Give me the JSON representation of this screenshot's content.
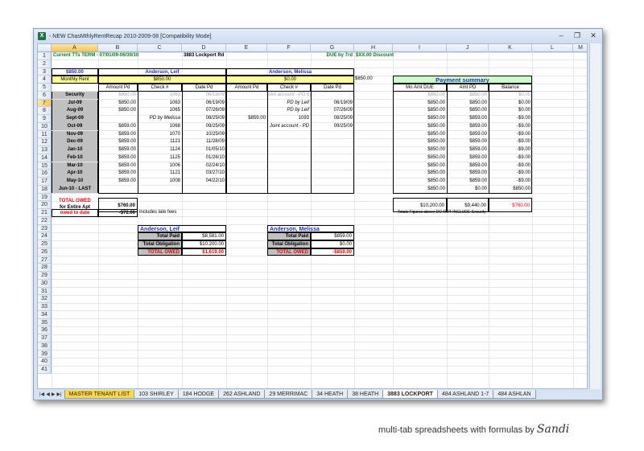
{
  "window": {
    "title": "- NEW ChasMthlyRentRecap 2010-2009-08  [Compatibility Mode]",
    "app_icon": "excel-icon"
  },
  "columns": [
    "A",
    "B",
    "C",
    "D",
    "E",
    "F",
    "G",
    "H",
    "I",
    "J",
    "K",
    "L",
    "M"
  ],
  "rows": [
    "1",
    "2",
    "3",
    "4",
    "5",
    "6",
    "7",
    "8",
    "9",
    "10",
    "11",
    "12",
    "13",
    "14",
    "15",
    "16",
    "17",
    "18",
    "19",
    "20",
    "21",
    "22",
    "23",
    "24",
    "25",
    "26",
    "27",
    "28",
    "29",
    "30",
    "31",
    "32",
    "33",
    "34",
    "35",
    "36",
    "37",
    "38",
    "39",
    "40",
    "41"
  ],
  "header": {
    "term": "Current TTs TERM -  07/01/09-06/30/10",
    "address": "3883 Lockport Rd",
    "due": "DUE by 7rd",
    "discount": "$XX.00 Discount"
  },
  "rent": {
    "amount": "$850.00",
    "label": "Monthly Rent",
    "h4": "$850.00"
  },
  "tenant1": {
    "name": "Anderson, Leif",
    "rent": "$850.00",
    "col_amt": "Amount Pd",
    "col_check": "Check #",
    "col_date": "Date Pd"
  },
  "tenant2": {
    "name": "Anderson, Melissa",
    "rent": "$0.00",
    "col_amt": "Amount Pd",
    "col_check": "Check #",
    "col_date": "Date Pd"
  },
  "summary": {
    "title": "Payment summary",
    "col_due": "Mo Amt DUE",
    "col_pd": "Amt PD",
    "col_bal": "Balance"
  },
  "ledger": [
    {
      "month": "Security",
      "a1": "$850.00",
      "c1": "1063",
      "d1": "06/19/09",
      "a2": "",
      "c2": "joint account - PD by Leif",
      "d2": "",
      "due": "$850.00",
      "pd": "$850.00",
      "bal": "$0.00"
    },
    {
      "month": "Jul-09",
      "a1": "$850.00",
      "c1": "1063",
      "d1": "06/19/09",
      "a2": "",
      "c2": "PD by Leif",
      "d2": "06/19/09",
      "due": "$850.00",
      "pd": "$850.00",
      "bal": "$0.00"
    },
    {
      "month": "Aug-09",
      "a1": "$850.00",
      "c1": "1065",
      "d1": "07/26/09",
      "a2": "",
      "c2": "PD by Leif",
      "d2": "07/26/09",
      "due": "$850.00",
      "pd": "$850.00",
      "bal": "$0.00"
    },
    {
      "month": "Sept-09",
      "a1": "",
      "c1": "PD by Melissa",
      "d1": "08/25/09",
      "a2": "$859.00",
      "c2": "1093",
      "d2": "08/25/09",
      "due": "$850.00",
      "pd": "$859.00",
      "bal": "-$9.00"
    },
    {
      "month": "Oct-09",
      "a1": "$859.00",
      "c1": "1068",
      "d1": "09/25/09",
      "a2": "",
      "c2": "Joint account - PD",
      "d2": "09/25/09",
      "due": "$850.00",
      "pd": "$859.00",
      "bal": "-$9.00"
    },
    {
      "month": "Nov-09",
      "a1": "$859.00",
      "c1": "1070",
      "d1": "10/25/09",
      "a2": "",
      "c2": "",
      "d2": "",
      "due": "$850.00",
      "pd": "$859.00",
      "bal": "-$9.00"
    },
    {
      "month": "Dec-09",
      "a1": "$859.00",
      "c1": "1121",
      "d1": "11/28/09",
      "a2": "",
      "c2": "",
      "d2": "",
      "due": "$850.00",
      "pd": "$859.00",
      "bal": "-$9.00"
    },
    {
      "month": "Jan-10",
      "a1": "$859.00",
      "c1": "1124",
      "d1": "01/05/10",
      "a2": "",
      "c2": "",
      "d2": "",
      "due": "$850.00",
      "pd": "$859.00",
      "bal": "-$9.00"
    },
    {
      "month": "Feb-10",
      "a1": "$859.00",
      "c1": "1125",
      "d1": "01/26/10",
      "a2": "",
      "c2": "",
      "d2": "",
      "due": "$850.00",
      "pd": "$859.00",
      "bal": "-$9.00"
    },
    {
      "month": "Mar-10",
      "a1": "$859.00",
      "c1": "1006",
      "d1": "02/24/10",
      "a2": "",
      "c2": "",
      "d2": "",
      "due": "$850.00",
      "pd": "$859.00",
      "bal": "-$9.00"
    },
    {
      "month": "Apr-10",
      "a1": "$859.00",
      "c1": "1121",
      "d1": "03/27/10",
      "a2": "",
      "c2": "",
      "d2": "",
      "due": "$850.00",
      "pd": "$859.00",
      "bal": "-$9.00"
    },
    {
      "month": "May-10",
      "a1": "$859.00",
      "c1": "1008",
      "d1": "04/22/10",
      "a2": "",
      "c2": "",
      "d2": "",
      "due": "$850.00",
      "pd": "$859.00",
      "bal": "-$9.00"
    },
    {
      "month": "Jun-10 - LAST",
      "a1": "",
      "c1": "",
      "d1": "",
      "a2": "",
      "c2": "",
      "d2": "",
      "due": "$850.00",
      "pd": "$0.00",
      "bal": "$850.00"
    }
  ],
  "totals": {
    "owed_label1": "TOTAL OWED",
    "owed_label2": "for Entire Apt",
    "owed_value": "$760.00",
    "date_label": "owed to date",
    "date_value": "-$72.00",
    "late_note": "includes late fees",
    "due_total": "$10,200.00",
    "pd_total": "$9,440.00",
    "bal_total": "$760.00",
    "note": "Totals Figures above DO NOT INCLUDE Security"
  },
  "box1": {
    "name": "Anderson, Leif",
    "paid_label": "Total Paid",
    "paid": "$8,581.00",
    "obl_label": "Total Obligation",
    "obl": "$10,200.00",
    "owed_label": "TOTAL OWED",
    "owed": "$1,619.00"
  },
  "box2": {
    "name": "Anderson, Melissa",
    "paid_label": "Total Paid",
    "paid": "$859.00",
    "obl_label": "Total Obligation",
    "obl": "$0.00",
    "owed_label": "TOTAL OWED",
    "owed": "-$859.00"
  },
  "tabs": [
    "MASTER TENANT LIST",
    "103 SHIRLEY",
    "184 HODGE",
    "262 ASHLAND",
    "29 MERRIMAC",
    "34 HEATH",
    "38 HEATH",
    "3883 LOCKPORT",
    "484 ASHLAND 1-7",
    "484 ASHLAN"
  ],
  "caption": {
    "text": "multi-tab spreadsheets with formulas by",
    "signature": "Sandi"
  }
}
